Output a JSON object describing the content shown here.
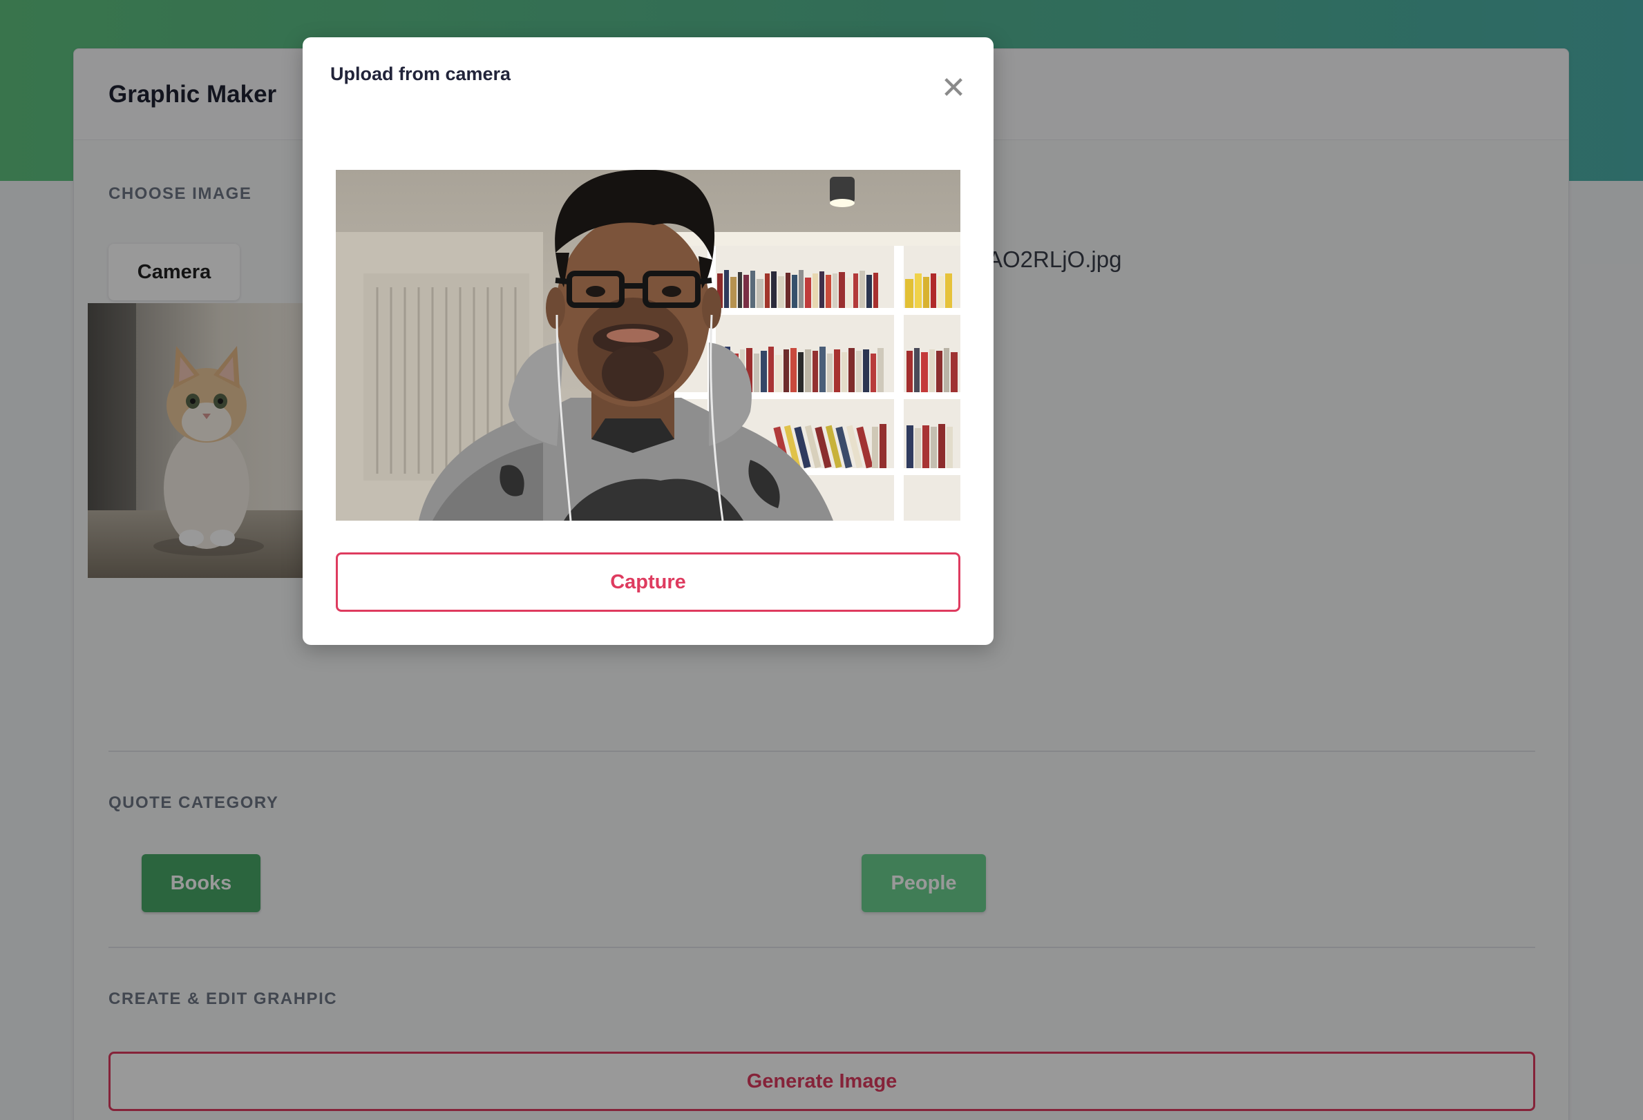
{
  "app": {
    "title": "Graphic Maker"
  },
  "choose_image": {
    "section_label": "CHOOSE IMAGE",
    "camera_label": "Camera",
    "filename": "AO2RLjO.jpg"
  },
  "quote_category": {
    "section_label": "QUOTE CATEGORY",
    "options": [
      {
        "label": "Books"
      },
      {
        "label": "People"
      }
    ]
  },
  "create_edit": {
    "section_label": "CREATE & EDIT GRAHPIC",
    "generate_label": "Generate Image"
  },
  "modal": {
    "title": "Upload from camera",
    "close_glyph": "✕",
    "capture_label": "Capture"
  },
  "colors": {
    "accent_red": "#de3b5f",
    "green_dark": "#48a868",
    "green_light": "#6cd08f"
  }
}
